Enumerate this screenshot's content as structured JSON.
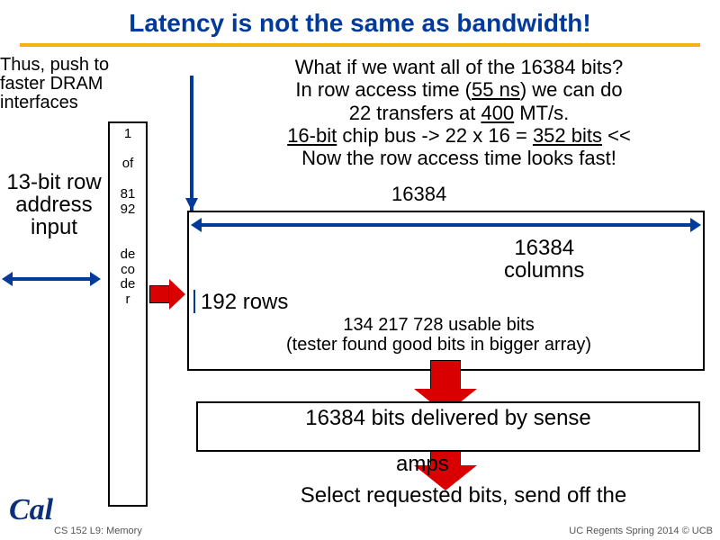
{
  "title": "Latency is not the same as bandwidth!",
  "push_text": "Thus, push to faster DRAM interfaces",
  "explain_html": {
    "l1": "What if we want all of the 16384 bits?",
    "l2a": "In row access time (",
    "l2_lat": "55 ns",
    "l2b": ") we can do",
    "l3a": "22 transfers at ",
    "l3_rate": "400",
    "l3b": " MT/s.",
    "l4a": "16-bit",
    "l4b": " chip bus -> 22 x 16 = ",
    "l4_bits": "352 bits",
    "l4c": " << ",
    "l5": "Now the row access time looks fast!"
  },
  "overlay_16384": "16384",
  "row_addr_label": "13-bit row address input",
  "decoder": {
    "one": "1",
    "of": "of",
    "n1": "81",
    "n2": "92",
    "d1": "de",
    "d2": "co",
    "d3": "de",
    "d4": "r"
  },
  "columns_label_num": "16384",
  "columns_label_word": "columns",
  "rows_label": "192 rows",
  "bits_line1": "134 217 728 usable bits",
  "bits_line2": "(tester found good bits in bigger array)",
  "sense_line1": "16384 bits delivered by sense",
  "sense_overflow": "amps",
  "select_text": "Select requested bits, send off the",
  "footer_left": "CS 152 L9: Memory",
  "footer_right": "UC Regents Spring 2014 © UCB",
  "logo": "Cal"
}
